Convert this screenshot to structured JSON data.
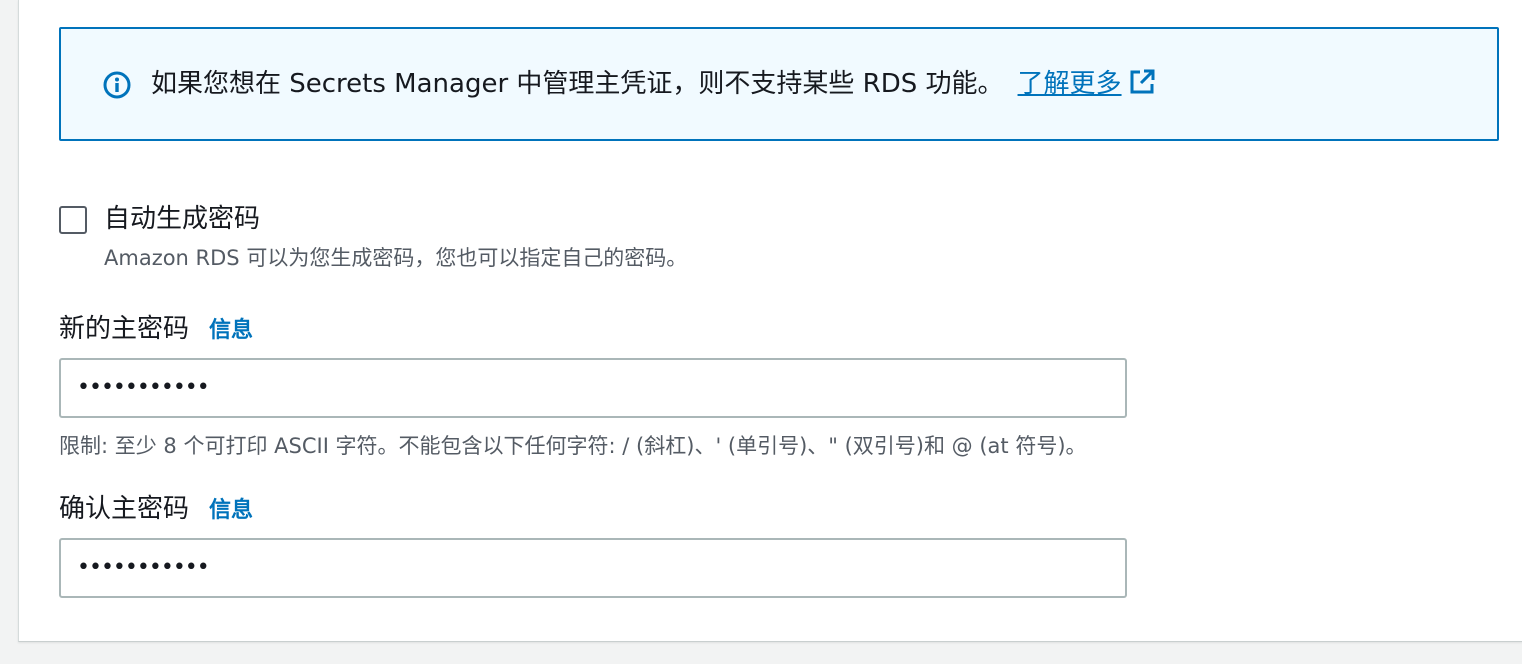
{
  "alert": {
    "icon": "info-circle-icon",
    "message": "如果您想在 Secrets Manager 中管理主凭证，则不支持某些 RDS 功能。",
    "link_label": "了解更多",
    "link_icon": "external-link-icon",
    "accent_color": "#0073bb",
    "background_color": "#f1faff"
  },
  "auto_generate": {
    "checked": false,
    "label": "自动生成密码",
    "description": "Amazon RDS 可以为您生成密码，您也可以指定自己的密码。"
  },
  "new_password": {
    "label": "新的主密码",
    "info_label": "信息",
    "value": "•••••••••••"
  },
  "constraint_text": "限制: 至少 8 个可打印 ASCII 字符。不能包含以下任何字符: / (斜杠)、' (单引号)、\" (双引号)和 @ (at 符号)。",
  "confirm_password": {
    "label": "确认主密码",
    "info_label": "信息",
    "value": "•••••••••••"
  }
}
